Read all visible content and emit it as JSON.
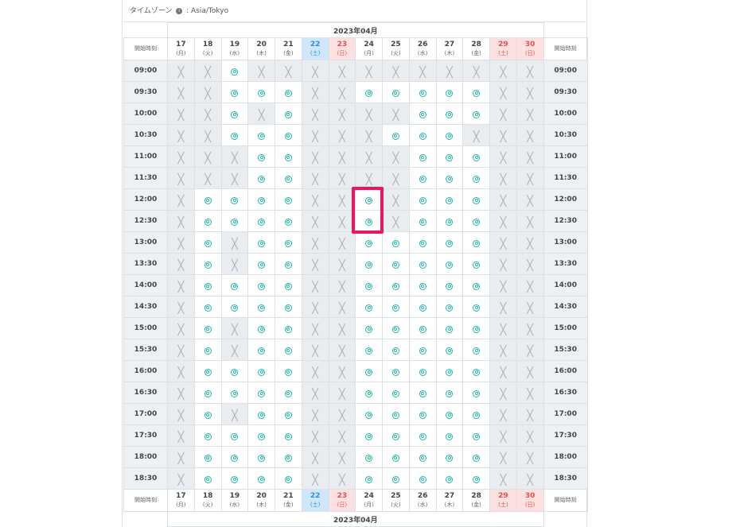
{
  "timezone": {
    "label": "タイムゾーン",
    "sep": ": ",
    "value": "Asia/Tokyo"
  },
  "month_label": "2023年04月",
  "start_time_label": "開始時刻",
  "days": [
    {
      "num": "17",
      "wd": "(月)",
      "type": "weekday"
    },
    {
      "num": "18",
      "wd": "(火)",
      "type": "weekday"
    },
    {
      "num": "19",
      "wd": "(水)",
      "type": "weekday"
    },
    {
      "num": "20",
      "wd": "(木)",
      "type": "weekday"
    },
    {
      "num": "21",
      "wd": "(金)",
      "type": "weekday"
    },
    {
      "num": "22",
      "wd": "(土)",
      "type": "sat"
    },
    {
      "num": "23",
      "wd": "(日)",
      "type": "sun"
    },
    {
      "num": "24",
      "wd": "(月)",
      "type": "weekday"
    },
    {
      "num": "25",
      "wd": "(火)",
      "type": "weekday"
    },
    {
      "num": "26",
      "wd": "(水)",
      "type": "weekday"
    },
    {
      "num": "27",
      "wd": "(木)",
      "type": "weekday"
    },
    {
      "num": "28",
      "wd": "(金)",
      "type": "weekday"
    },
    {
      "num": "29",
      "wd": "(土)",
      "type": "sun"
    },
    {
      "num": "30",
      "wd": "(日)",
      "type": "sun"
    }
  ],
  "slots": [
    {
      "time": "09:00",
      "avail": "xxoxxxxxxxxxxx"
    },
    {
      "time": "09:30",
      "avail": "xxoooxxoooooxx"
    },
    {
      "time": "10:00",
      "avail": "xxoxoxxxxoooxx"
    },
    {
      "time": "10:30",
      "avail": "xxoooxxxoooxxx"
    },
    {
      "time": "11:00",
      "avail": "xxxooxxxxoooxx"
    },
    {
      "time": "11:30",
      "avail": "xxxooxxxxoooxx"
    },
    {
      "time": "12:00",
      "avail": "xooooxxoxoooxx"
    },
    {
      "time": "12:30",
      "avail": "xooooxxoxoooxx"
    },
    {
      "time": "13:00",
      "avail": "xoxooxxoooooxx"
    },
    {
      "time": "13:30",
      "avail": "xoxooxxoooooxx"
    },
    {
      "time": "14:00",
      "avail": "xooooxxoooooxx"
    },
    {
      "time": "14:30",
      "avail": "xooooxxoooooxx"
    },
    {
      "time": "15:00",
      "avail": "xoxooxxoooooxx"
    },
    {
      "time": "15:30",
      "avail": "xoxooxxoooooxx"
    },
    {
      "time": "16:00",
      "avail": "xooooxxoooooxx"
    },
    {
      "time": "16:30",
      "avail": "xooooxxoooooxx"
    },
    {
      "time": "17:00",
      "avail": "xoxooxxoooooxx"
    },
    {
      "time": "17:30",
      "avail": "xooooxxoooooxx"
    },
    {
      "time": "18:00",
      "avail": "xooooxxoooooxx"
    },
    {
      "time": "18:30",
      "avail": "xooooxxoooooxx"
    }
  ],
  "icons": {
    "available": "double-circle-icon",
    "unavailable": "cross-icon",
    "info": "info-icon"
  },
  "colors": {
    "available": "#1fb6a8",
    "unavailable": "#a7b1b9",
    "saturday": "#2f8de4",
    "sunday": "#e0524f",
    "highlight": "#ea1564"
  }
}
